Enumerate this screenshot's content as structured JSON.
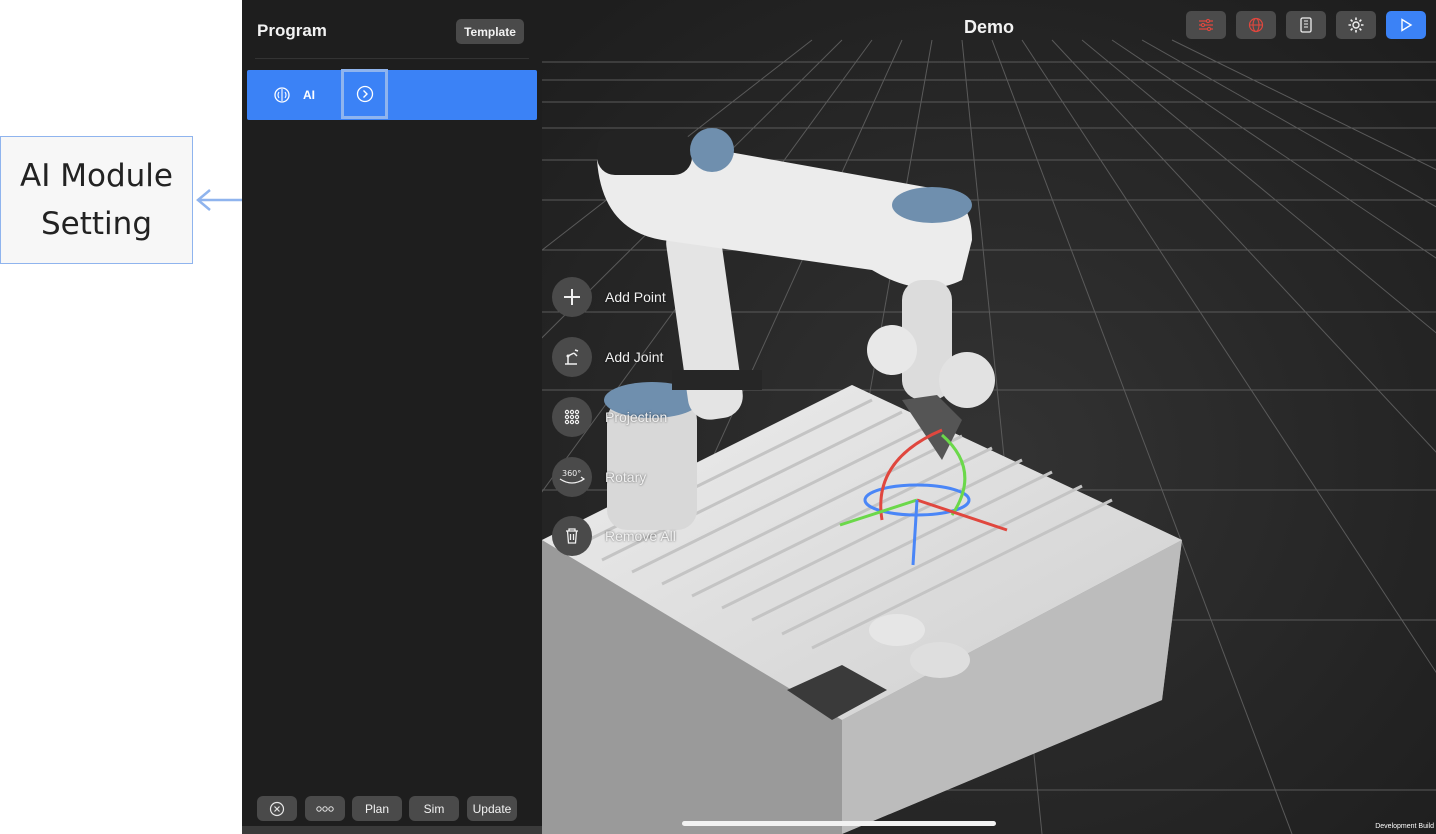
{
  "annotation": {
    "callout_line1": "AI  Module",
    "callout_line2": "Setting",
    "color": "#8fb4ee"
  },
  "panel": {
    "title": "Program",
    "template_label": "Template",
    "items": [
      {
        "label": "AI",
        "icon": "brain-icon",
        "action_icon": "chevron-right-circle-icon",
        "color": "#3b82f6"
      }
    ],
    "bottom_buttons": {
      "close_icon": "close-circle-icon",
      "more_icon": "more-dots-icon",
      "plan_label": "Plan",
      "sim_label": "Sim",
      "update_label": "Update"
    }
  },
  "viewport": {
    "title": "Demo",
    "toolbar": {
      "icons": [
        "sliders-icon",
        "globe-icon",
        "document-icon",
        "gear-icon",
        "play-icon"
      ],
      "accent": "#3b82f6",
      "alert_color": "#e0473e"
    },
    "fab_menu": [
      {
        "label": "Add Point",
        "icon": "plus-icon"
      },
      {
        "label": "Add Joint",
        "icon": "robot-joint-icon"
      },
      {
        "label": "Projection",
        "icon": "grid-dots-icon"
      },
      {
        "label": "Rotary",
        "icon": "rotate-360-icon"
      },
      {
        "label": "Remove All",
        "icon": "trash-icon"
      }
    ],
    "footer_text": "Development Build"
  }
}
